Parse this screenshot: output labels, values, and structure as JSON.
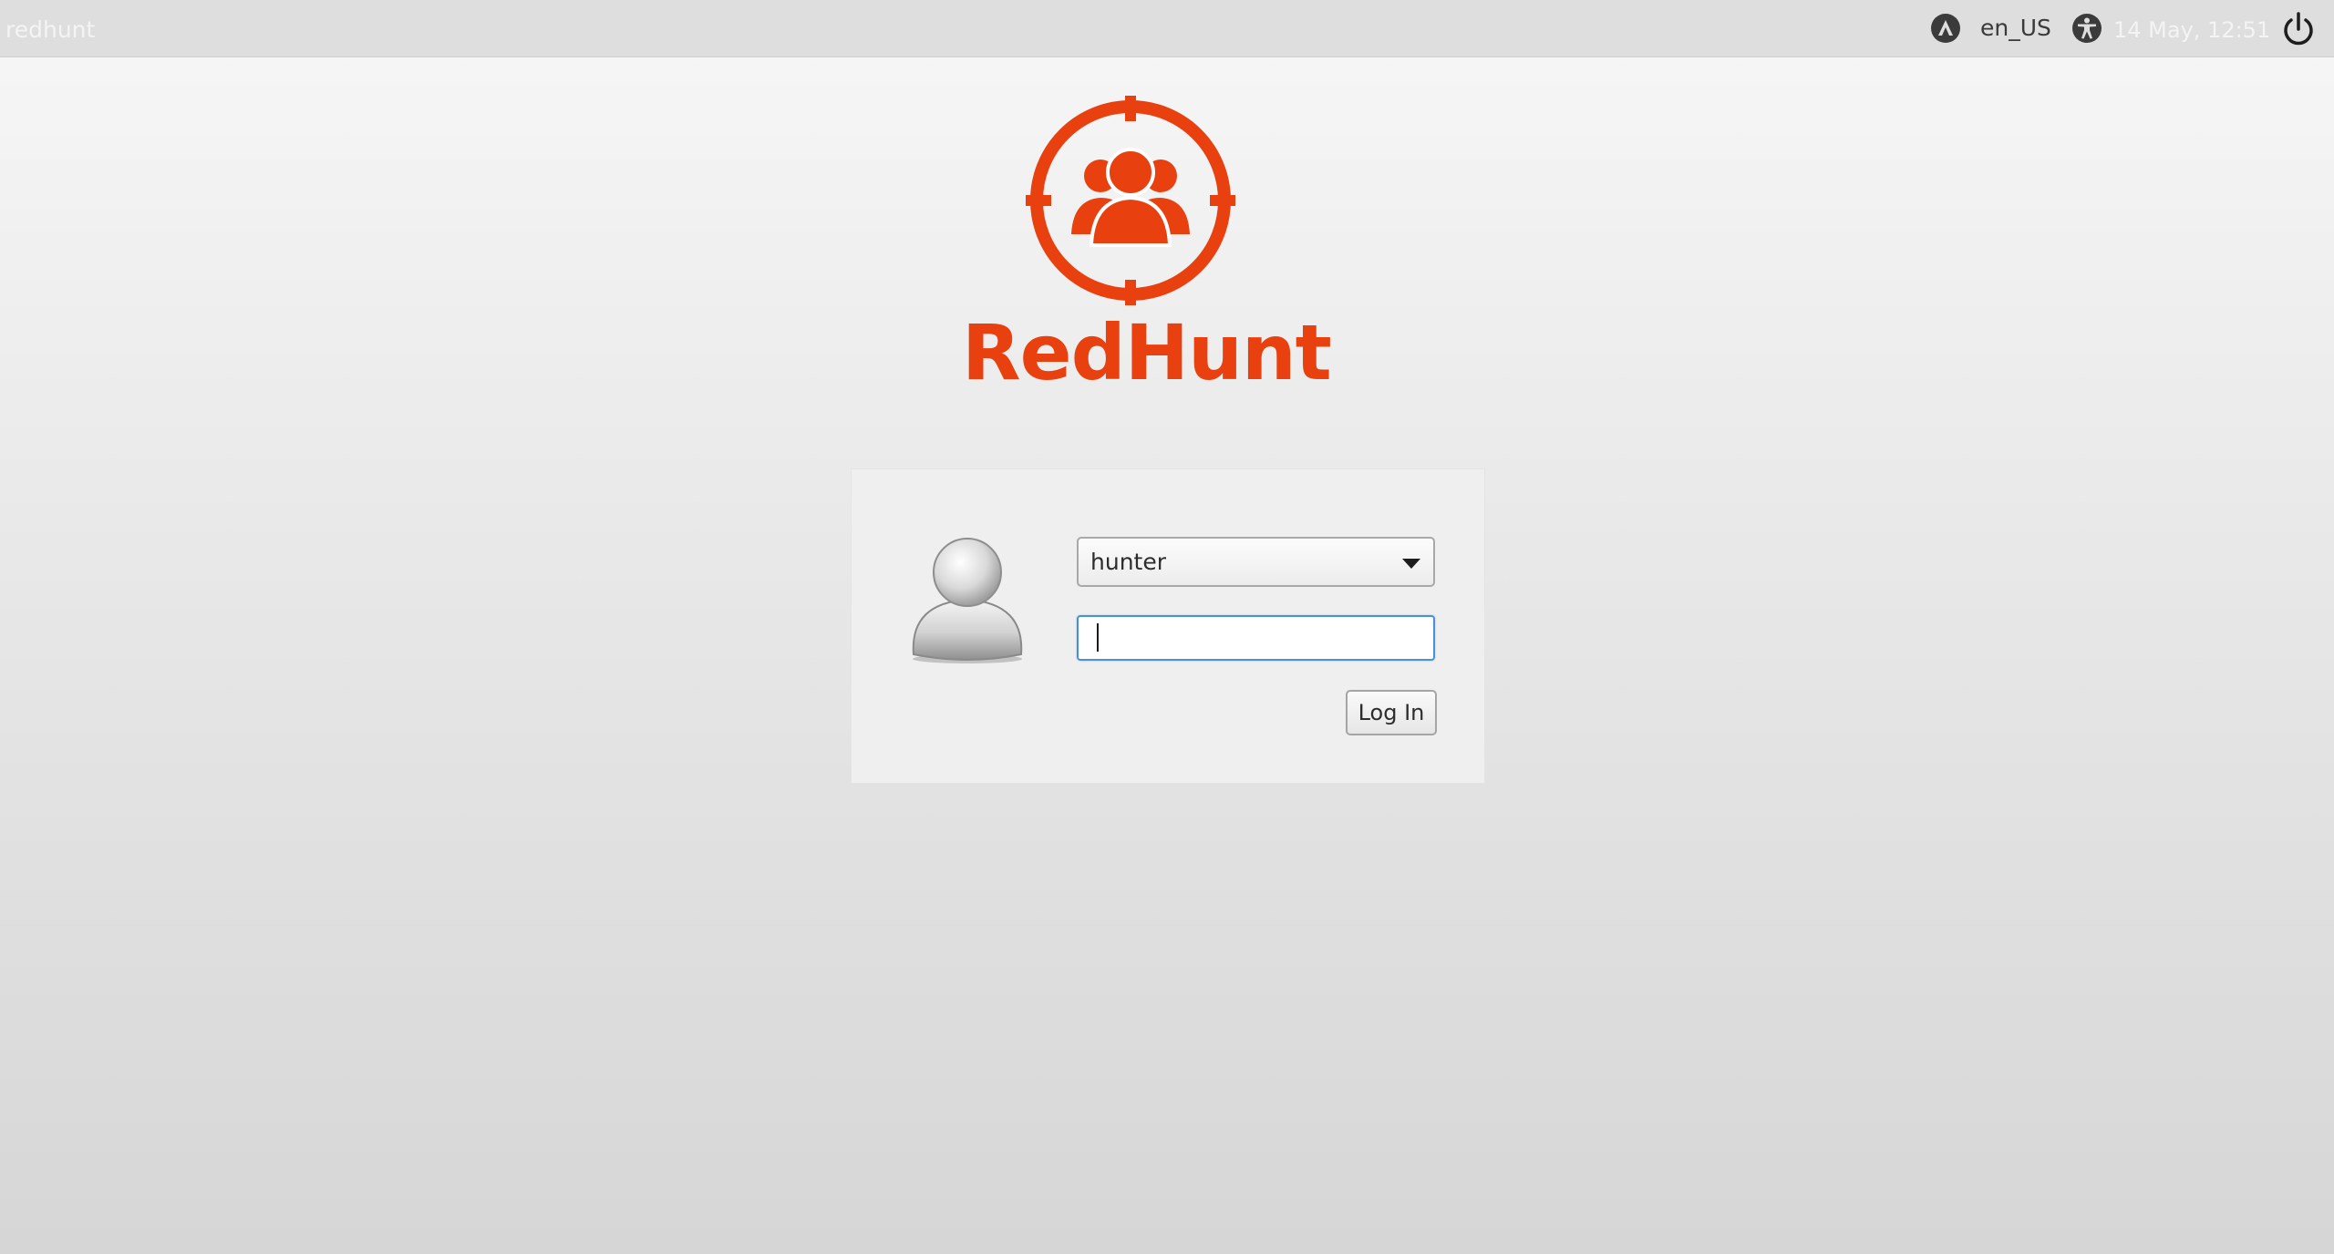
{
  "top_panel": {
    "hostname": "redhunt",
    "keyboard_layout_icon": "keyboard-layout-icon",
    "language": "en_US",
    "accessibility_icon": "accessibility-icon",
    "clock": "14 May, 12:51",
    "power_icon": "power-icon"
  },
  "branding": {
    "logo_icon": "crosshair-users-icon",
    "logo_text": "RedHunt",
    "brand_color": "#e8400f"
  },
  "login": {
    "avatar_icon": "user-avatar-icon",
    "selected_user": "hunter",
    "password_value": "",
    "login_button_label": "Log In",
    "focus_color": "#4a90d9"
  }
}
